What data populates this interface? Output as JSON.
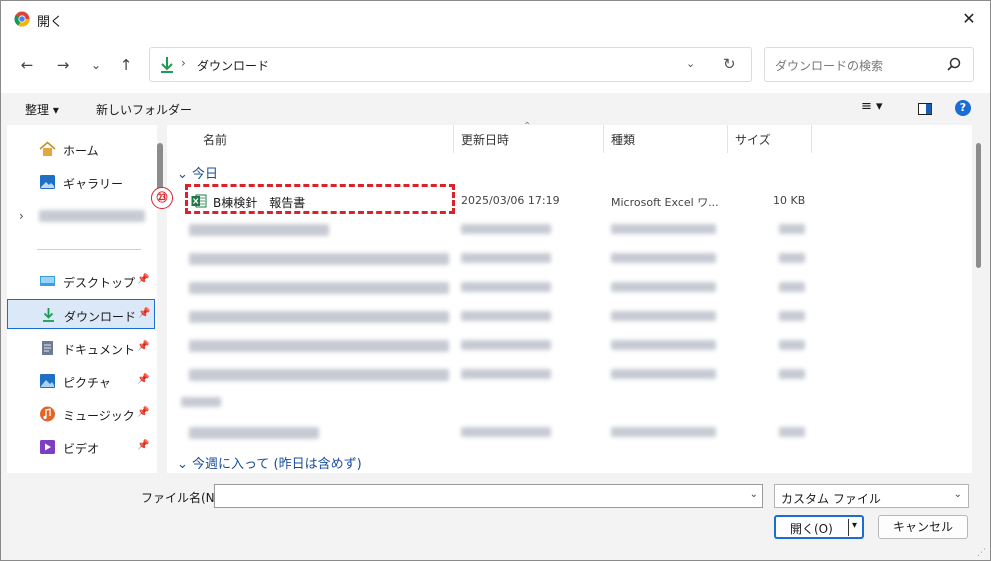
{
  "window": {
    "title": "開く",
    "close": "✕"
  },
  "nav": {
    "back": "←",
    "forward": "→",
    "recent": "⌄",
    "up": "↑",
    "path_sep": "›",
    "path": "ダウンロード",
    "dropdown": "⌄",
    "refresh": "↻",
    "search_placeholder": "ダウンロードの検索"
  },
  "toolbar": {
    "organize": "整理 ▾",
    "new_folder": "新しいフォルダー",
    "view": "≡ ▾",
    "help": "?"
  },
  "sidebar": {
    "top": [
      {
        "label": "ホーム"
      },
      {
        "label": "ギャラリー"
      }
    ],
    "chevron": "›",
    "pinned": [
      {
        "label": "デスクトップ"
      },
      {
        "label": "ダウンロード"
      },
      {
        "label": "ドキュメント"
      },
      {
        "label": "ピクチャ"
      },
      {
        "label": "ミュージック"
      },
      {
        "label": "ビデオ"
      }
    ],
    "pin": "📌"
  },
  "columns": {
    "name": "名前",
    "modified": "更新日時",
    "type": "種類",
    "size": "サイズ",
    "sort": "⌃"
  },
  "groups": {
    "today": "今日",
    "this_week": "今週に入って (昨日は含めず)"
  },
  "files": [
    {
      "name": "B棟検針　報告書",
      "modified": "2025/03/06 17:19",
      "type": "Microsoft Excel ワ...",
      "size": "10 KB"
    }
  ],
  "annotation": {
    "badge": "㉓"
  },
  "bottom": {
    "filename_label": "ファイル名(N):",
    "filter": "カスタム ファイル",
    "open": "開く(O)",
    "open_arrow": "▾",
    "cancel": "キャンセル",
    "dropdown": "⌄"
  },
  "colors": {
    "accent": "#1a6dd4",
    "highlight": "#d9222a",
    "excel": "#1d7a45"
  }
}
